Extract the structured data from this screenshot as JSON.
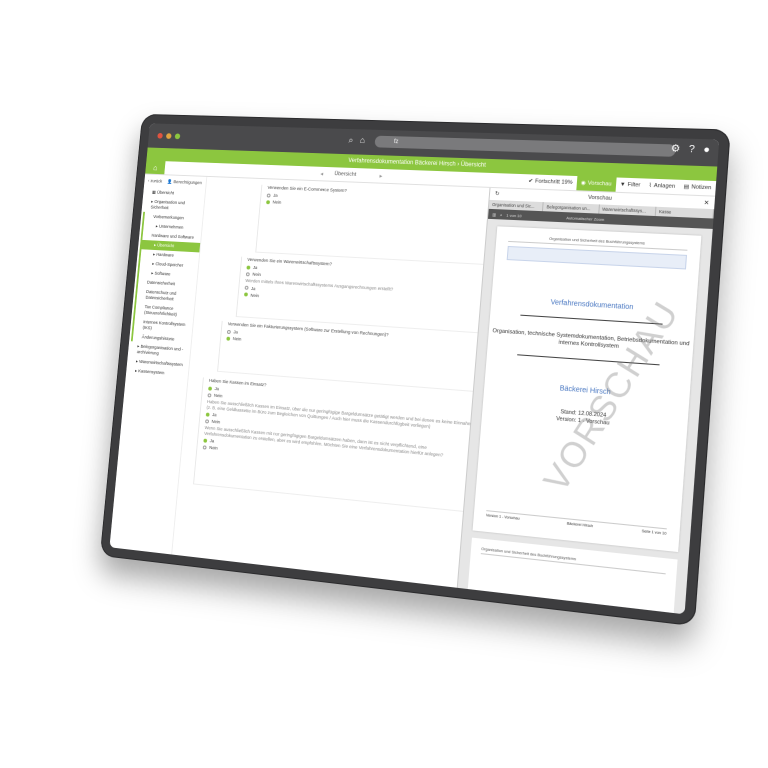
{
  "window": {
    "title": "Verfahrensdokumentation Bäckerei Hirsch › Übersicht",
    "address": "fz"
  },
  "toolbar": {
    "center_label": "Übersicht",
    "progress": "Fortschritt 19%",
    "preview": "Vorschau",
    "filter": "Filter",
    "attachments": "Anlagen",
    "notes": "Notizen"
  },
  "sidebar": {
    "back": "zurück",
    "permissions": "Berechtigungen",
    "items": [
      {
        "label": "Übersicht",
        "level": 1
      },
      {
        "label": "Organisation und Sicherheit",
        "level": 1
      },
      {
        "label": "Vorbemerkungen",
        "level": 2
      },
      {
        "label": "Unternehmen",
        "level": 3
      },
      {
        "label": "Hardware und Software",
        "level": 2
      },
      {
        "label": "Übersicht",
        "level": 3,
        "active": true
      },
      {
        "label": "Hardware",
        "level": 3
      },
      {
        "label": "Cloud-Speicher",
        "level": 3
      },
      {
        "label": "Software",
        "level": 3
      },
      {
        "label": "Datensicherheit",
        "level": 2
      },
      {
        "label": "Datenschutz und Datensicherheit",
        "level": 2
      },
      {
        "label": "Tax Compliance (Steuerehrlichkeit)",
        "level": 2
      },
      {
        "label": "Internes Kontrollsystem (IKS)",
        "level": 2
      },
      {
        "label": "Änderungshistorie",
        "level": 2
      },
      {
        "label": "Belegorganisation und -archivierung",
        "level": 1
      },
      {
        "label": "Warenwirtschaftssystem",
        "level": 1
      },
      {
        "label": "Kassensystem",
        "level": 1
      }
    ]
  },
  "questions": [
    {
      "text": "Verwenden Sie ein E-Commerce System?",
      "options": [
        "Ja",
        "Nein"
      ],
      "selected": 1
    },
    {
      "text": "Verwenden Sie ein Warenwirtschaftssystem?",
      "options": [
        "Ja",
        "Nein"
      ],
      "selected": 0,
      "followup": "Werden mittels Ihres Warenwirtschaftssystems Ausgangsrechnungen erstellt?",
      "followup_options": [
        "Ja",
        "Nein"
      ],
      "followup_selected": 1
    },
    {
      "text": "Verwenden Sie ein Fakturierungssystem (Software zur Erstellung von Rechnungen)?",
      "options": [
        "Ja",
        "Nein"
      ],
      "selected": 1
    },
    {
      "text": "Haben Sie Kassen im Einsatz?",
      "options": [
        "Ja",
        "Nein"
      ],
      "selected": 0,
      "note1": "Haben Sie ausschließlich Kassen im Einsatz, über die nur geringfügige Bargeldumsätze getätigt werden und bei denen es keine Einnahmen (z. B. eine Geldkassette im Büro zum Begleichen von Quittungen / Auch hier muss die Kassendurchfügbeit vorliegen)",
      "note1_options": [
        "Ja",
        "Nein"
      ],
      "note1_selected": 0,
      "note2": "Wenn Sie ausschließlich Kassen mit nur geringfügigen Bargeldumsätzen haben, dann ist es nicht verpflichtend, eine Verfahrensdokumentation zu erstellen, aber es wird empfohlen. Möchten Sie eine Verfahrensdokumentation hierfür anlegen?",
      "note2_options": [
        "Ja",
        "Nein"
      ],
      "note2_selected": 0
    }
  ],
  "preview": {
    "title": "Vorschau",
    "tabs": [
      "Organisation und Sic...",
      "Belegorganisation un...",
      "Warenwirtschaftssys...",
      "Kasse"
    ],
    "controls": [
      "1 von 10",
      "Automatischer Zoom"
    ],
    "page": {
      "header": "Organisation und Sicherheit des Buchführungssystems",
      "doc_title": "Verfahrensdokumentation",
      "subtitle": "Organisation, technische Systemdokumentation, Betriebsdokumentation und internes Kontrollsystem",
      "firm": "Bäckerei Hirsch",
      "date": "Stand: 12.08.2024",
      "version": "Version: 1 - Vorschau",
      "watermark": "VORSCHAU",
      "footer": [
        "Version 1 - Vorschau",
        "Bäckerei Hirsch",
        "Seite 1 von 10"
      ]
    },
    "page2_header": "Organisation und Sicherheit des Buchführungssystems"
  },
  "colors": {
    "accent": "#8cc63f",
    "frame": "#3d3d3f",
    "link": "#4a78c2"
  }
}
